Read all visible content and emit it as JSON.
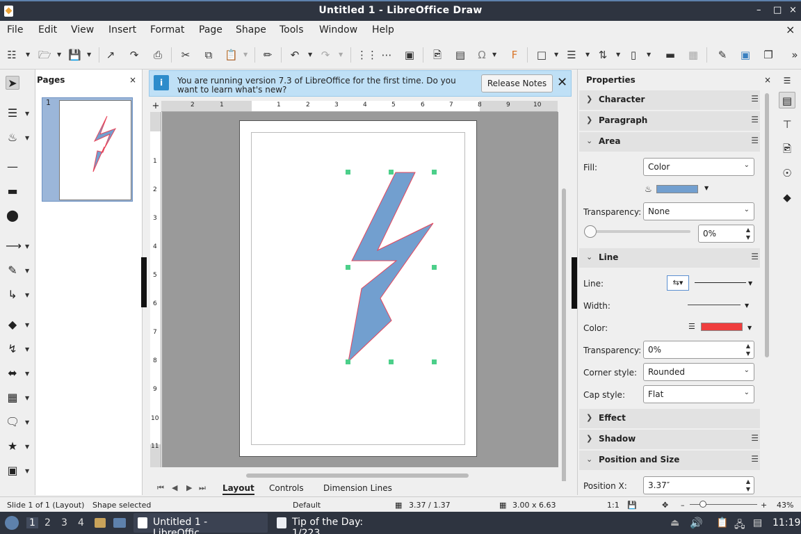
{
  "window": {
    "title": "Untitled 1 - LibreOffice Draw",
    "min": "–",
    "max": "□",
    "close": "×"
  },
  "menubar": {
    "items": [
      "File",
      "Edit",
      "View",
      "Insert",
      "Format",
      "Page",
      "Shape",
      "Tools",
      "Window",
      "Help"
    ],
    "close": "×"
  },
  "infobar": {
    "message": "You are running version 7.3 of LibreOffice for the first time. Do you want to learn what's new?",
    "button": "Release Notes",
    "icon": "i",
    "close": "✕"
  },
  "pages_panel": {
    "title": "Pages",
    "close": "×",
    "page_number": "1"
  },
  "ruler": {
    "corner": "+",
    "top_labels": [
      "2",
      "1",
      "1",
      "1",
      "2",
      "3",
      "4",
      "5",
      "6",
      "7",
      "8",
      "9",
      "10"
    ],
    "left_labels": [
      "1",
      "2",
      "3",
      "4",
      "5",
      "6",
      "7",
      "8",
      "9",
      "10",
      "11"
    ]
  },
  "tabs": {
    "items": [
      "Layout",
      "Controls",
      "Dimension Lines"
    ],
    "active": "Layout",
    "nav": [
      "⏮",
      "◀",
      "▶",
      "⏭"
    ]
  },
  "properties": {
    "title": "Properties",
    "close": "×",
    "sections": {
      "character": "Character",
      "paragraph": "Paragraph",
      "area": "Area",
      "line": "Line",
      "effect": "Effect",
      "shadow": "Shadow",
      "position_size": "Position and Size"
    },
    "area": {
      "fill_label": "Fill:",
      "fill_value": "Color",
      "fill_color": "#729fcf",
      "transparency_label": "Transparency:",
      "transparency_value": "None",
      "transparency_percent": "0%"
    },
    "line": {
      "line_label": "Line:",
      "width_label": "Width:",
      "color_label": "Color:",
      "color": "#ef3e3e",
      "transparency_label": "Transparency:",
      "transparency_value": "0%",
      "corner_label": "Corner style:",
      "corner_value": "Rounded",
      "cap_label": "Cap style:",
      "cap_value": "Flat"
    },
    "position": {
      "x_label": "Position X:",
      "x_value": "3.37″"
    }
  },
  "statusbar": {
    "slide": "Slide 1 of 1 (Layout)",
    "selection": "Shape selected",
    "master": "Default",
    "position": "3.37 / 1.37",
    "size": "3.00 x 6.63",
    "scale": "1:1",
    "zoom": "43%",
    "zoom_minus": "–",
    "zoom_plus": "+"
  },
  "taskbar": {
    "workspaces": [
      "1",
      "2",
      "3",
      "4"
    ],
    "window1": "Untitled 1 - LibreOffic...",
    "window2": "Tip of the Day: 1/223",
    "clock": "11:19"
  },
  "shape": {
    "fill": "#729fcf",
    "stroke": "#e8455a",
    "handle": "#4ccf8a"
  }
}
